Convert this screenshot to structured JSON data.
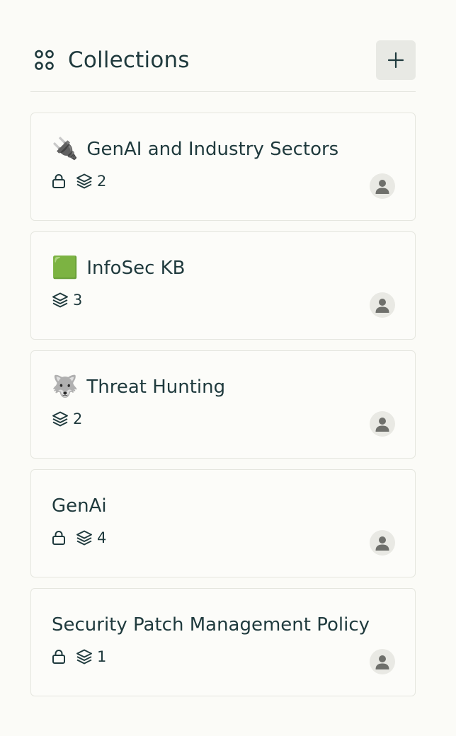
{
  "header": {
    "title": "Collections",
    "icon": "collections-icon",
    "add_button_label": "+"
  },
  "collections": [
    {
      "emoji": "🔌",
      "title": "GenAI and Industry Sectors",
      "private": true,
      "count": "2",
      "owner_icon": "user-avatar-icon"
    },
    {
      "emoji": "🟩",
      "title": "InfoSec KB",
      "private": false,
      "count": "3",
      "owner_icon": "user-avatar-icon"
    },
    {
      "emoji": "🐺",
      "title": "Threat Hunting",
      "private": false,
      "count": "2",
      "owner_icon": "user-avatar-icon"
    },
    {
      "emoji": "",
      "title": "GenAi",
      "private": true,
      "count": "4",
      "owner_icon": "user-avatar-icon"
    },
    {
      "emoji": "",
      "title": "Security Patch Management Policy",
      "private": true,
      "count": "1",
      "owner_icon": "user-avatar-icon"
    }
  ],
  "colors": {
    "text": "#1f3a3d",
    "background": "#fbfbf7",
    "button_bg": "#e8e9e4",
    "avatar_bg": "#e9e9e4",
    "avatar_fg": "#6f706c"
  }
}
